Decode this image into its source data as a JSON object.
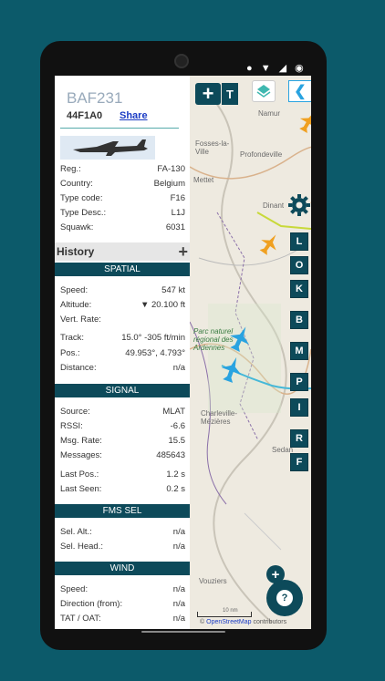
{
  "status_icons": "● ▼ ◢ ◉",
  "panel": {
    "callsign": "BAF231",
    "hex": "44F1A0",
    "share_label": "Share",
    "info": [
      {
        "label": "Reg.:",
        "value": "FA-130"
      },
      {
        "label": "Country:",
        "value": "Belgium"
      },
      {
        "label": "Type code:",
        "value": "F16"
      },
      {
        "label": "Type Desc.:",
        "value": "L1J"
      },
      {
        "label": "Squawk:",
        "value": "6031"
      }
    ],
    "history_label": "History",
    "history_add": "+",
    "spatial_title": "SPATIAL",
    "spatial": [
      {
        "label": "Speed:",
        "value": "547 kt"
      },
      {
        "label": "Altitude:",
        "value": "▼ 20.100 ft"
      },
      {
        "label": "Vert. Rate:",
        "value": ""
      },
      {
        "label": "Track:",
        "value": "15.0° -305 ft/min"
      },
      {
        "label": "Pos.:",
        "value": "49.953°, 4.793°"
      },
      {
        "label": "Distance:",
        "value": "n/a"
      }
    ],
    "signal_title": "SIGNAL",
    "signal": [
      {
        "label": "Source:",
        "value": "MLAT"
      },
      {
        "label": "RSSI:",
        "value": "-6.6"
      },
      {
        "label": "Msg. Rate:",
        "value": "15.5"
      },
      {
        "label": "Messages:",
        "value": "485643"
      },
      {
        "label": "Last Pos.:",
        "value": "1.2 s"
      },
      {
        "label": "Last Seen:",
        "value": "0.2 s"
      }
    ],
    "fms_title": "FMS SEL",
    "fms": [
      {
        "label": "Sel. Alt.:",
        "value": "n/a"
      },
      {
        "label": "Sel. Head.:",
        "value": "n/a"
      }
    ],
    "wind_title": "WIND",
    "wind": [
      {
        "label": "Speed:",
        "value": "n/a"
      },
      {
        "label": "Direction (from):",
        "value": "n/a"
      },
      {
        "label": "TAT / OAT:",
        "value": "n/a"
      }
    ]
  },
  "map": {
    "labels": [
      "Namur",
      "Fosses-la-Ville",
      "Profondeville",
      "Mettet",
      "Dinant",
      "Charleville-Mézières",
      "Vouziers",
      "Sedan"
    ],
    "park_label": "Parc naturel régional des Ardennes",
    "toolbar": {
      "add": "+",
      "t_label": "T",
      "back": "❮"
    },
    "side_buttons": [
      "L",
      "O",
      "K",
      "B",
      "M",
      "P",
      "I",
      "R",
      "F"
    ],
    "help": "?",
    "scale_label": "10 nm",
    "attribution_prefix": "©",
    "attribution_link": "OpenStreetMap",
    "attribution_suffix": " contributors"
  },
  "colors": {
    "accent": "#0d4a5a",
    "aircraft_selected": "#29a3e0",
    "aircraft_other": "#f0a020",
    "trail": "#45b8d8"
  }
}
